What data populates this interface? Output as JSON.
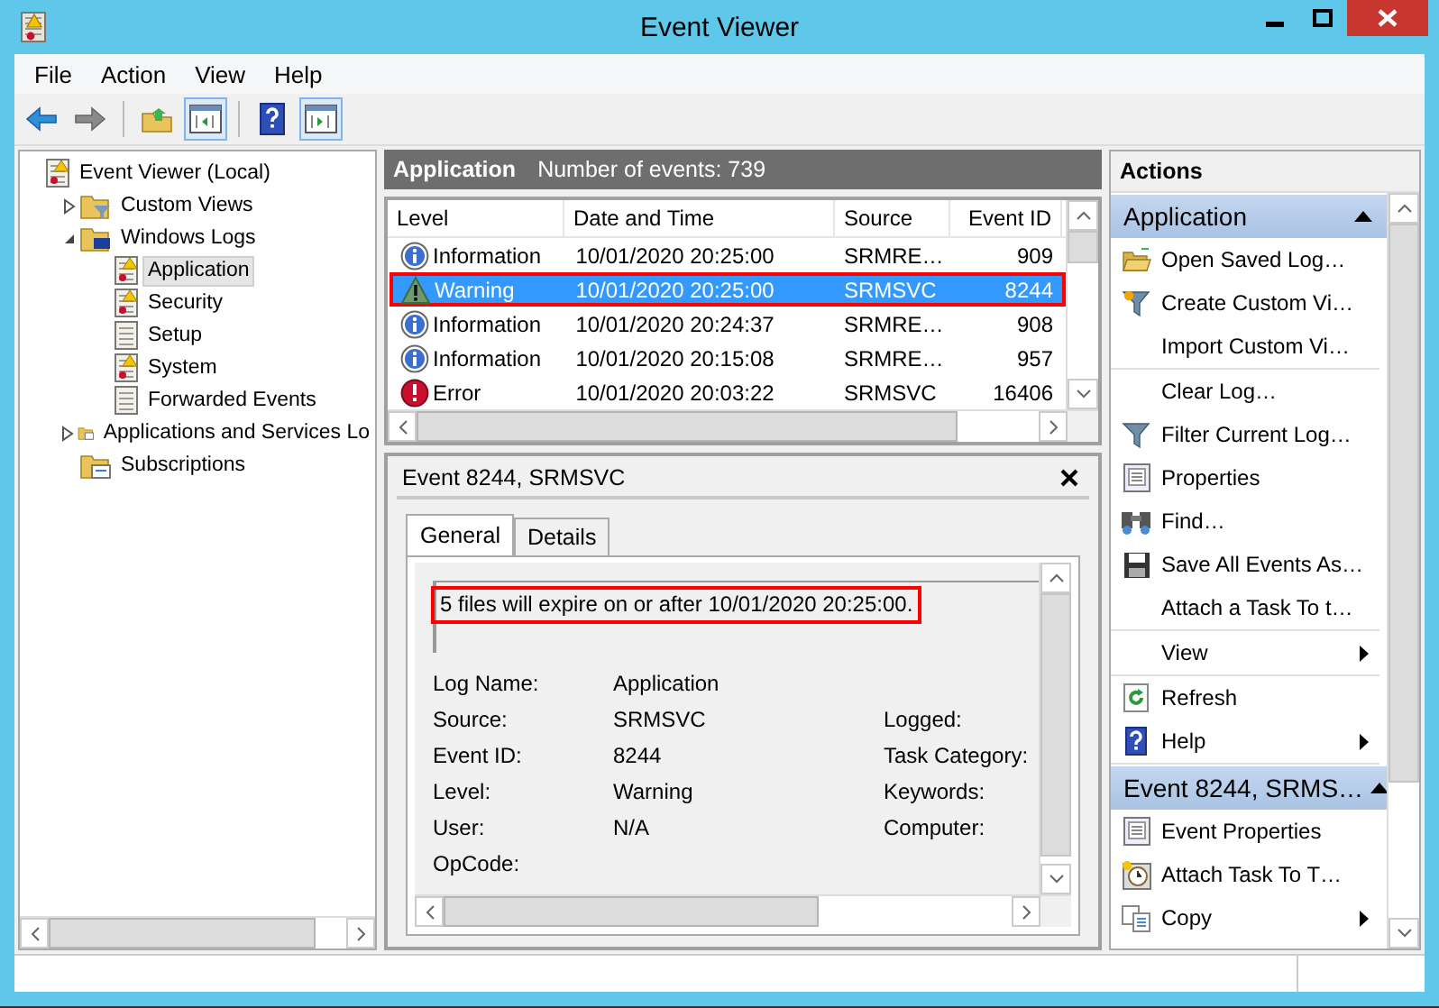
{
  "window": {
    "title": "Event Viewer"
  },
  "menu": [
    {
      "label": "File"
    },
    {
      "label": "Action"
    },
    {
      "label": "View"
    },
    {
      "label": "Help"
    }
  ],
  "toolbar": [
    {
      "kind": "back",
      "on": false
    },
    {
      "kind": "forward",
      "on": false
    },
    {
      "kind": "up",
      "on": false
    },
    {
      "kind": "tree",
      "on": true
    },
    {
      "kind": "help",
      "on": false
    },
    {
      "kind": "pane",
      "on": true
    }
  ],
  "tree": [
    {
      "label": "Event Viewer (Local)",
      "kind": "viewer",
      "selected": false,
      "children": [
        {
          "label": "Custom Views",
          "kind": "folder-filter",
          "expanded": false,
          "selected": false
        },
        {
          "label": "Windows Logs",
          "kind": "folder-monitor",
          "expanded": true,
          "selected": false,
          "children": [
            {
              "label": "Application",
              "kind": "log-warning",
              "selected": true
            },
            {
              "label": "Security",
              "kind": "log-warning",
              "selected": false
            },
            {
              "label": "Setup",
              "kind": "log",
              "selected": false
            },
            {
              "label": "System",
              "kind": "log-warning",
              "selected": false
            },
            {
              "label": "Forwarded Events",
              "kind": "log",
              "selected": false
            }
          ]
        },
        {
          "label": "Applications and Services Lo",
          "kind": "folder-window",
          "expanded": false,
          "selected": false
        },
        {
          "label": "Subscriptions",
          "kind": "subscriptions",
          "selected": false
        }
      ]
    }
  ],
  "log_header": {
    "title": "Application",
    "count": "Number of events: 739"
  },
  "events": {
    "columns": [
      "Level",
      "Date and Time",
      "Source",
      "Event ID"
    ],
    "rows": [
      {
        "kind": "information",
        "level": "Information",
        "date": "10/01/2020 20:25:00",
        "source": "SRMRE…",
        "event_id": "909",
        "selected": false,
        "annotated": false
      },
      {
        "kind": "warning",
        "level": "Warning",
        "date": "10/01/2020 20:25:00",
        "source": "SRMSVC",
        "event_id": "8244",
        "selected": true,
        "annotated": true
      },
      {
        "kind": "information",
        "level": "Information",
        "date": "10/01/2020 20:24:37",
        "source": "SRMRE…",
        "event_id": "908",
        "selected": false,
        "annotated": false
      },
      {
        "kind": "information",
        "level": "Information",
        "date": "10/01/2020 20:15:08",
        "source": "SRMRE…",
        "event_id": "957",
        "selected": false,
        "annotated": false
      },
      {
        "kind": "error",
        "level": "Error",
        "date": "10/01/2020 20:03:22",
        "source": "SRMSVC",
        "event_id": "16406",
        "selected": false,
        "annotated": false
      }
    ]
  },
  "event_detail": {
    "title": "Event 8244, SRMSVC",
    "tabs": [
      {
        "label": "General",
        "selected": true
      },
      {
        "label": "Details",
        "selected": false
      }
    ],
    "message": "5 files will expire on or after 10/01/2020 20:25:00.",
    "message_annotated": true,
    "fields": [
      {
        "label": "Log Name:",
        "value": "Application"
      },
      {
        "label": "Source:",
        "value": "SRMSVC",
        "label_2": "Logged:"
      },
      {
        "label": "Event ID:",
        "value": "8244",
        "label_2": "Task Category:"
      },
      {
        "label": "Level:",
        "value": "Warning",
        "label_2": "Keywords:"
      },
      {
        "label": "User:",
        "value": "N/A",
        "label_2": "Computer:"
      },
      {
        "label": "OpCode:"
      }
    ]
  },
  "actions": {
    "title": "Actions",
    "sections": [
      {
        "title": "Application",
        "expanded": true,
        "groups": [
          [
            {
              "label": "Open Saved Log…",
              "kind": "open",
              "submenu": false
            },
            {
              "label": "Create Custom Vi…",
              "kind": "filter-star",
              "submenu": false
            },
            {
              "label": "Import Custom Vi…",
              "kind": "none",
              "submenu": false
            }
          ],
          [
            {
              "label": "Clear Log…",
              "kind": "none",
              "submenu": false
            },
            {
              "label": "Filter Current Log…",
              "kind": "filter",
              "submenu": false
            },
            {
              "label": "Properties",
              "kind": "properties",
              "submenu": false
            },
            {
              "label": "Find…",
              "kind": "find",
              "submenu": false
            },
            {
              "label": "Save All Events As…",
              "kind": "save",
              "submenu": false
            },
            {
              "label": "Attach a Task To t…",
              "kind": "none",
              "submenu": false
            }
          ],
          [
            {
              "label": "View",
              "kind": "none",
              "submenu": true
            }
          ],
          [
            {
              "label": "Refresh",
              "kind": "refresh",
              "submenu": false
            },
            {
              "label": "Help",
              "kind": "help",
              "submenu": true
            }
          ]
        ]
      },
      {
        "title": "Event 8244, SRMS…",
        "expanded": true,
        "groups": [
          [
            {
              "label": "Event Properties",
              "kind": "properties",
              "submenu": false
            },
            {
              "label": "Attach Task To T…",
              "kind": "task",
              "submenu": false
            },
            {
              "label": "Copy",
              "kind": "copy",
              "submenu": true
            }
          ]
        ]
      }
    ]
  }
}
